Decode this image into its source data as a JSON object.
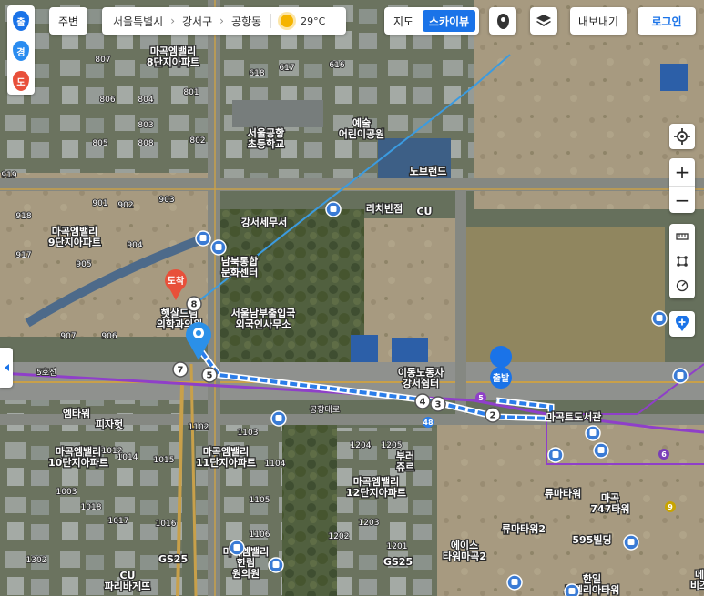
{
  "left_toolbar": [
    {
      "label": "출",
      "color": "#1a73e8"
    },
    {
      "label": "경",
      "color": "#2a8cf0"
    },
    {
      "label": "도",
      "color": "#e8503a"
    }
  ],
  "topbar": {
    "nearby_label": "주변",
    "breadcrumb": [
      "서울특별시",
      "강서구",
      "공항동"
    ],
    "weather_temp": "29°C",
    "weather_icon": "sun-icon",
    "map_label": "지도",
    "skyview_label": "스카이뷰",
    "export_label": "내보내기",
    "login_label": "로그인"
  },
  "right_controls": [
    "my-location-icon",
    "zoom-in-icon",
    "zoom-out-icon",
    "ruler-icon",
    "area-measure-icon",
    "radius-measure-icon",
    "add-place-icon"
  ],
  "route": {
    "start_label": "출발",
    "arrival_label": "도착",
    "waypoints": [
      "8",
      "7",
      "5",
      "4",
      "3",
      "2"
    ]
  },
  "map_labels": {
    "buildings": [
      "마곡엠밸리 8단지아파트",
      "서울공항 초등학교",
      "예술 어린이공원",
      "노브랜드",
      "리치반점",
      "CU",
      "강서세무서",
      "마곡엠밸리 9단지아파트",
      "남북통합 문화센터",
      "서울남부출입국 외국인사무소",
      "햇살드림 의학과의원",
      "이동노동자 강서쉼터",
      "엠타워",
      "피자헛",
      "마곡엠밸리 10단지아파트",
      "마곡엠밸리 11단지아파트",
      "부러 쥬르",
      "마곡엠밸리 12단지아파트",
      "류마타워",
      "마곡 747타워",
      "류마타워2",
      "595빌딩",
      "에이스 타워마곡2",
      "GS25",
      "한일 노벨리아타워",
      "CU 파리바게뜨",
      "마곡엠밸리 한림 원의원",
      "마곡트도서관",
      "GS25",
      "메 비즈"
    ],
    "building_numbers": [
      "807",
      "806",
      "805",
      "801",
      "808",
      "618",
      "617",
      "616",
      "804",
      "803",
      "802",
      "903",
      "902",
      "901",
      "904",
      "905",
      "906",
      "907",
      "918",
      "917",
      "919",
      "1003",
      "1012",
      "1013",
      "1014",
      "1015",
      "1018",
      "1017",
      "1016",
      "1102",
      "1103",
      "1104",
      "1105",
      "1106",
      "1204",
      "1205",
      "1202",
      "1203",
      "1201",
      "1302"
    ],
    "road_labels": [
      "공항대로",
      "5호선"
    ],
    "line_numbers": [
      "5",
      "6",
      "9",
      "48"
    ]
  },
  "colors": {
    "accent": "#1a73e8",
    "route": "#2b7de9",
    "arrival": "#e8503a",
    "line5": "#8f3fc9"
  }
}
